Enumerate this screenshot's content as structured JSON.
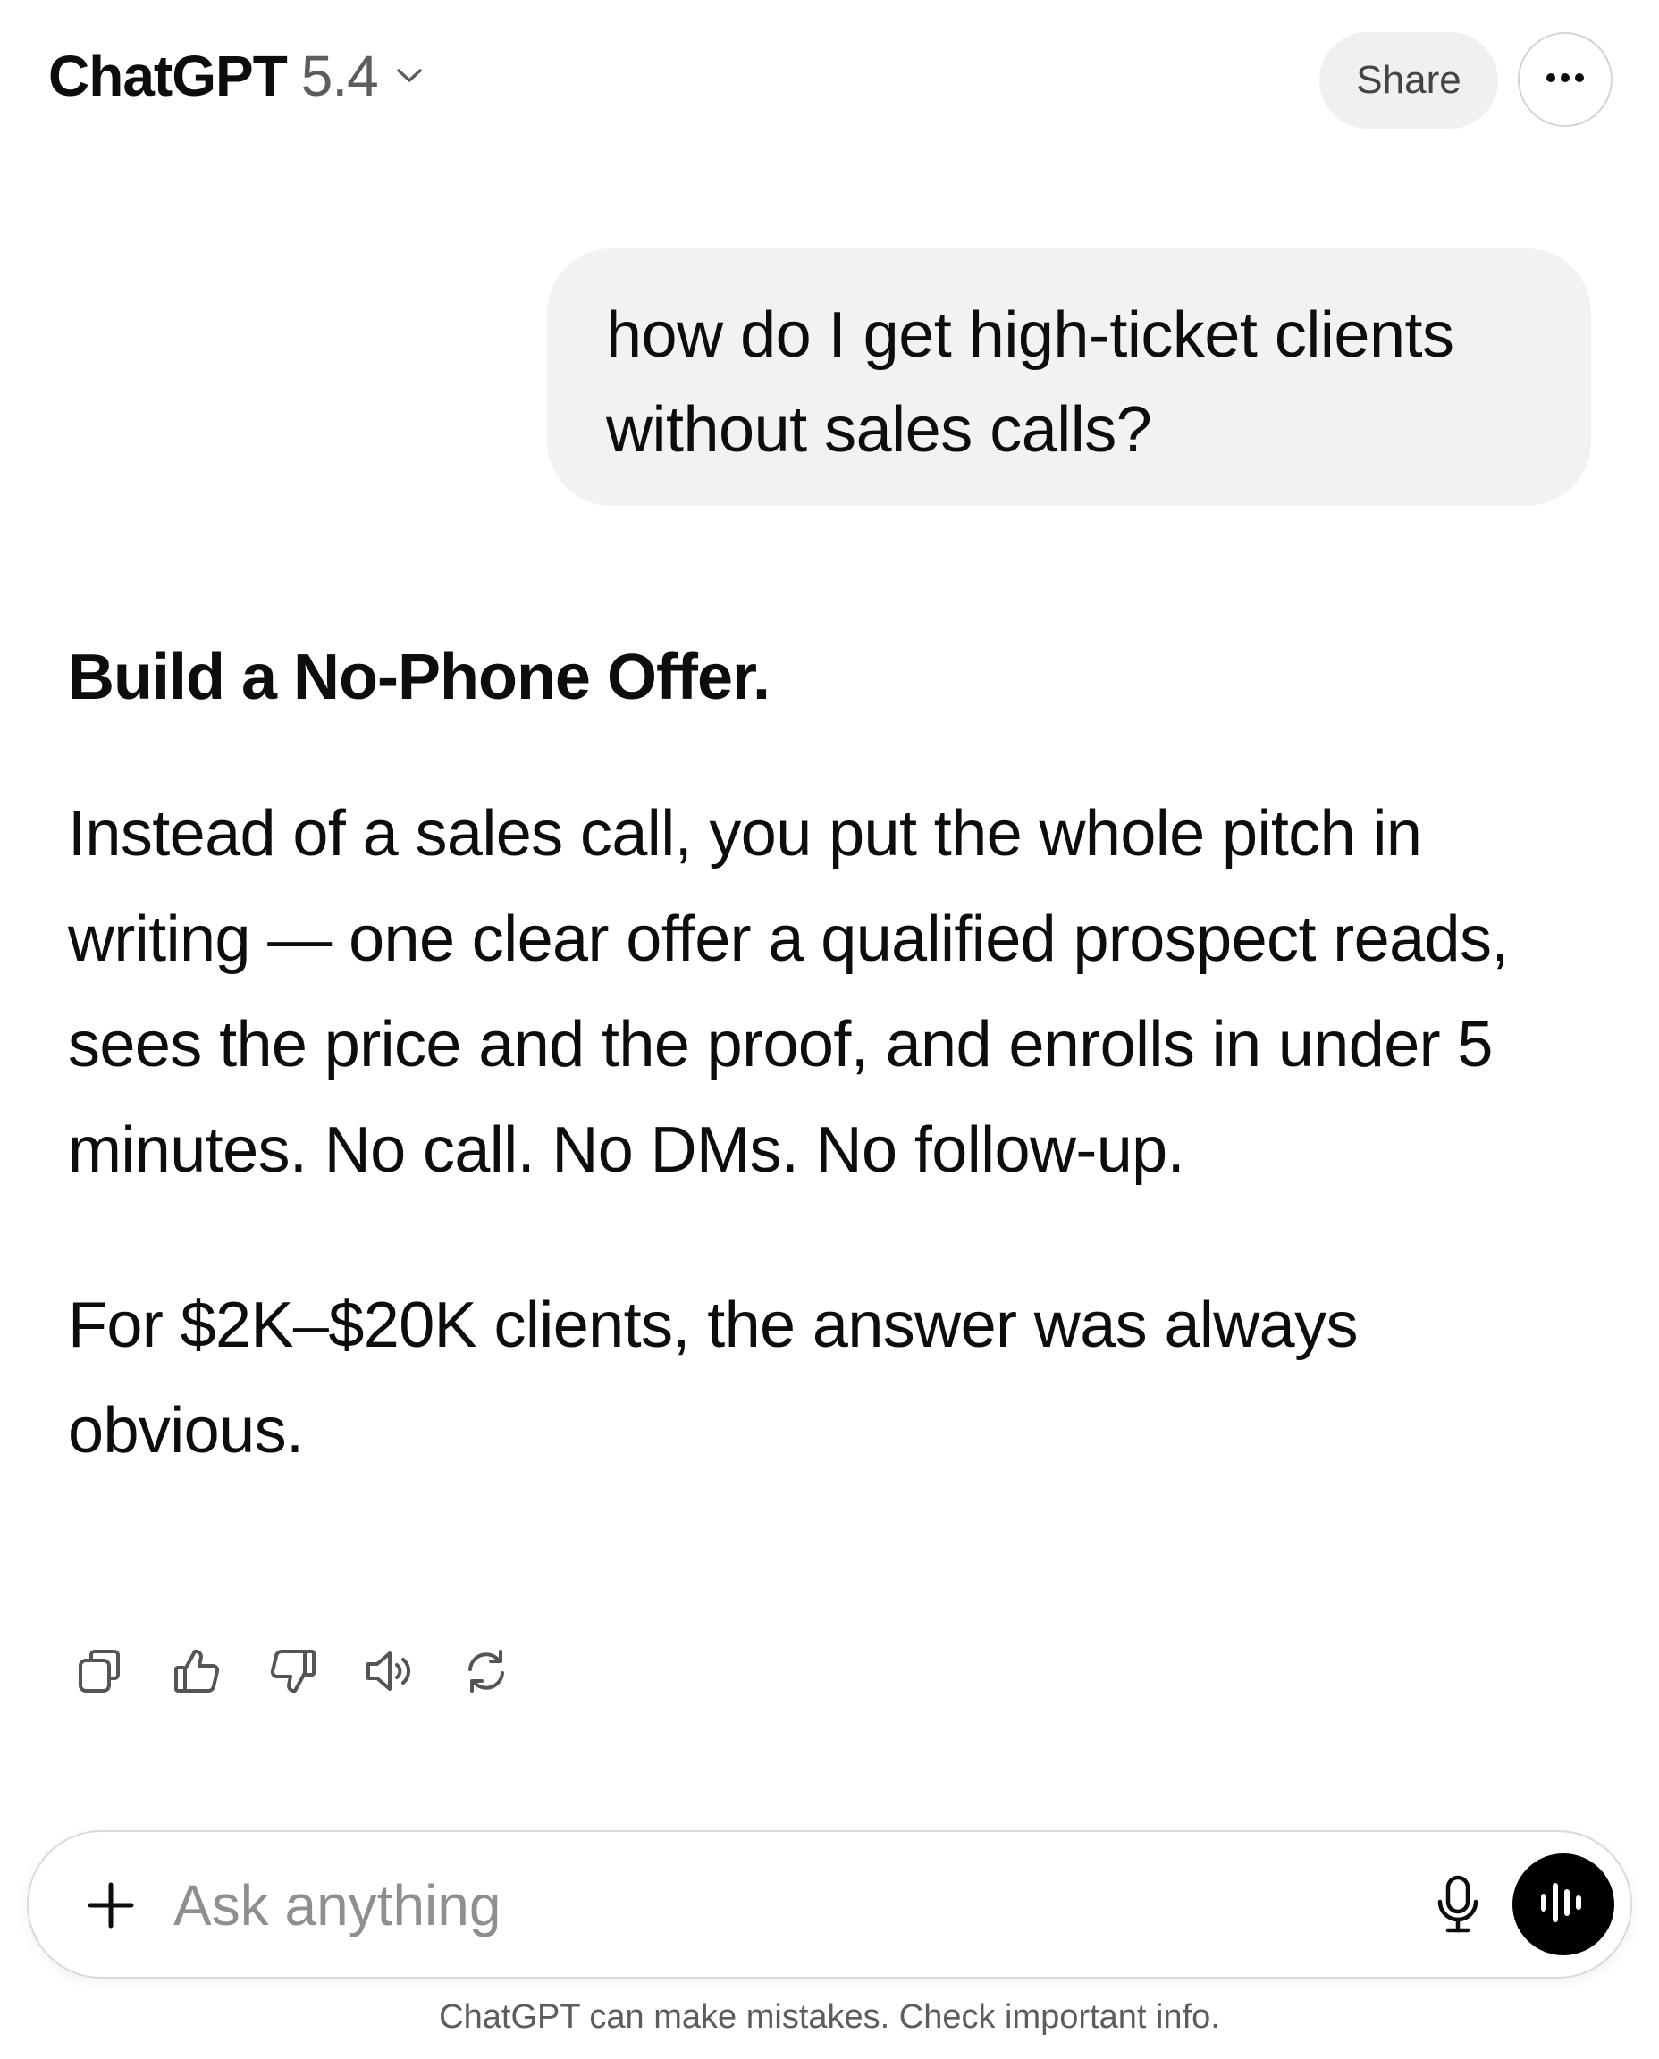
{
  "header": {
    "model_name": "ChatGPT",
    "model_version": "5.4",
    "share_label": "Share"
  },
  "conversation": {
    "user_message_lines": [
      "how do I get high-ticket clients",
      "without sales calls?"
    ],
    "assistant": {
      "heading": "Build a No-Phone Offer.",
      "paragraph_1": "Instead of a sales call, you put the whole pitch in writing — one clear offer a qualified prospect reads, sees the price and the proof, and enrolls in under 5 minutes. No call. No DMs. No follow-up.",
      "paragraph_2": "For $2K–$20K clients, the answer was always obvious."
    },
    "actions": [
      "copy-icon",
      "thumbs-up-icon",
      "thumbs-down-icon",
      "read-aloud-icon",
      "regenerate-icon"
    ]
  },
  "composer": {
    "placeholder": "Ask anything"
  },
  "footer": {
    "disclaimer": "ChatGPT can make mistakes. Check important info."
  }
}
